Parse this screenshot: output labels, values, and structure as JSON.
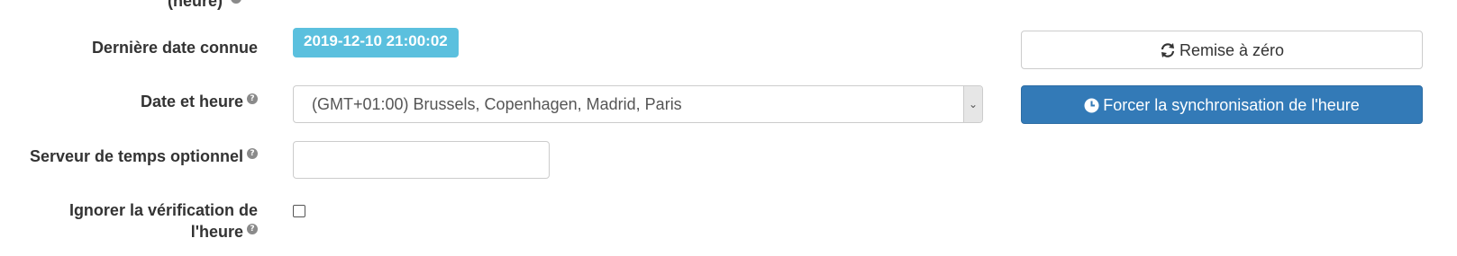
{
  "form": {
    "previous_label_fragment": "(heure)",
    "last_known_date_label": "Dernière date connue",
    "last_known_date_value": "2019-12-10 21:00:02",
    "datetime_label": "Date et heure",
    "timezone_selected": "(GMT+01:00) Brussels, Copenhagen, Madrid, Paris",
    "time_server_label": "Serveur de temps optionnel",
    "time_server_value": "",
    "ignore_check_label_line1": "Ignorer la vérification de",
    "ignore_check_label_line2": "l'heure",
    "ignore_check_checked": false
  },
  "buttons": {
    "reset_label": "Remise à zéro",
    "force_sync_label": "Forcer la synchronisation de l'heure"
  },
  "icons": {
    "help": "question-circle-icon",
    "reset": "refresh-icon",
    "sync": "clock-icon",
    "select": "chevron-down-icon"
  },
  "colors": {
    "badge_bg": "#5bc0de",
    "primary_bg": "#337ab7",
    "help_icon": "#8a8a8a"
  }
}
